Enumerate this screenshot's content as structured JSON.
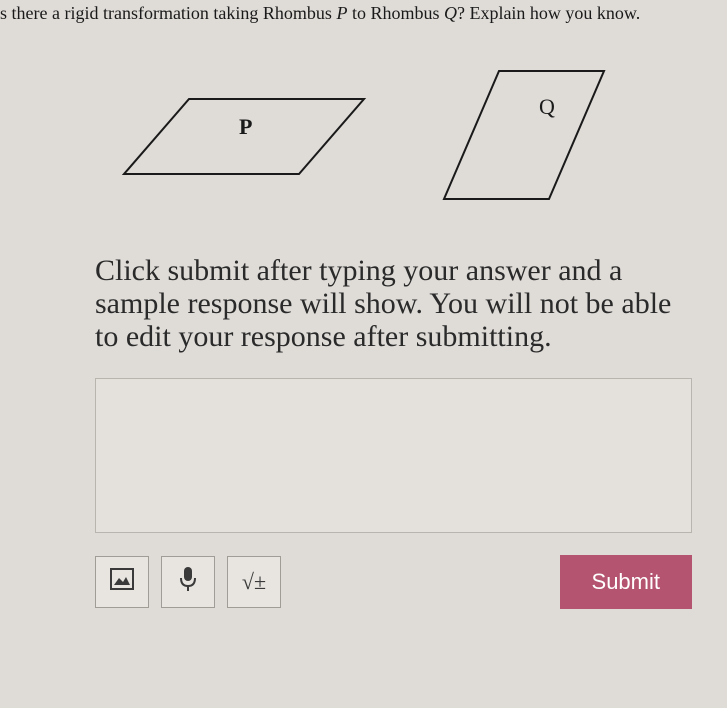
{
  "question": {
    "prefix": "s there a rigid transformation taking Rhombus ",
    "var1": "P",
    "middle": " to Rhombus ",
    "var2": "Q",
    "suffix": "? Explain how you know."
  },
  "figure": {
    "labelP": "P",
    "labelQ": "Q"
  },
  "instructions": "Click submit after typing your answer and a sample response will show. You will not be able to edit your response after submitting.",
  "toolbar": {
    "image_label": "🖼",
    "mic_label": "🎤",
    "math_label": "√±",
    "submit_label": "Submit"
  }
}
